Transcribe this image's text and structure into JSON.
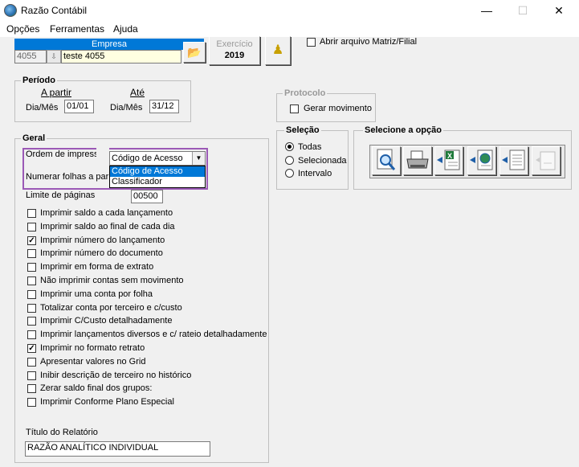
{
  "window": {
    "title": "Razão Contábil",
    "minimize": "—",
    "maximize": "☐",
    "close": "✕"
  },
  "menu": [
    "Opções",
    "Ferramentas",
    "Ajuda"
  ],
  "empresa": {
    "header": "Empresa",
    "code": "4055",
    "name": "teste 4055"
  },
  "exercicio": {
    "label": "Exercício",
    "year": "2019"
  },
  "abrir_matriz": {
    "label": "Abrir arquivo Matriz/Filial",
    "checked": false
  },
  "periodo": {
    "title": "Período",
    "from_label": "A partir",
    "to_label": "Até",
    "from_field_label": "Dia/Mês",
    "to_field_label": "Dia/Mês",
    "from_value": "01/01",
    "to_value": "31/12"
  },
  "protocolo": {
    "title": "Protocolo",
    "gerar_label": "Gerar movimento"
  },
  "selecao": {
    "title": "Seleção",
    "options": [
      "Todas",
      "Selecionada",
      "Intervalo"
    ],
    "selected": 0
  },
  "opcao": {
    "title": "Selecione a opção",
    "icons": [
      "preview-icon",
      "printer-icon",
      "excel-export-icon",
      "web-export-icon",
      "document-export-icon",
      "disabled-export-icon"
    ]
  },
  "geral": {
    "title": "Geral",
    "ordem_label": "Ordem de impressão",
    "ordem_value": "Código de Acesso",
    "ordem_options": [
      "Código de Acesso",
      "Classificador"
    ],
    "numerar_label": "Numerar folhas a par",
    "limite_label": "Limite de páginas",
    "limite_value": "00500",
    "checkboxes": [
      {
        "label": "Imprimir saldo a cada lançamento",
        "checked": false
      },
      {
        "label": "Imprimir saldo ao final de cada dia",
        "checked": false
      },
      {
        "label": "Imprimir número do lançamento",
        "checked": true
      },
      {
        "label": "Imprimir número do documento",
        "checked": false
      },
      {
        "label": "Imprimir em forma de extrato",
        "checked": false
      },
      {
        "label": "Não imprimir contas sem movimento",
        "checked": false
      },
      {
        "label": "Imprimir uma conta por folha",
        "checked": false
      },
      {
        "label": "Totalizar conta por terceiro e c/custo",
        "checked": false
      },
      {
        "label": "Imprimir C/Custo detalhadamente",
        "checked": false
      },
      {
        "label": "Imprimir lançamentos diversos e c/ rateio detalhadamente",
        "checked": false
      },
      {
        "label": "Imprimir no formato retrato",
        "checked": true
      },
      {
        "label": "Apresentar valores no Grid",
        "checked": false
      },
      {
        "label": "Inibir descrição de terceiro no histórico",
        "checked": false
      },
      {
        "label": "Zerar saldo final dos grupos:",
        "checked": false
      },
      {
        "label": "Imprimir Conforme Plano Especial",
        "checked": false
      }
    ],
    "titulo_label": "Título do Relatório",
    "titulo_value": "RAZÃO ANALÍTICO INDIVIDUAL"
  }
}
